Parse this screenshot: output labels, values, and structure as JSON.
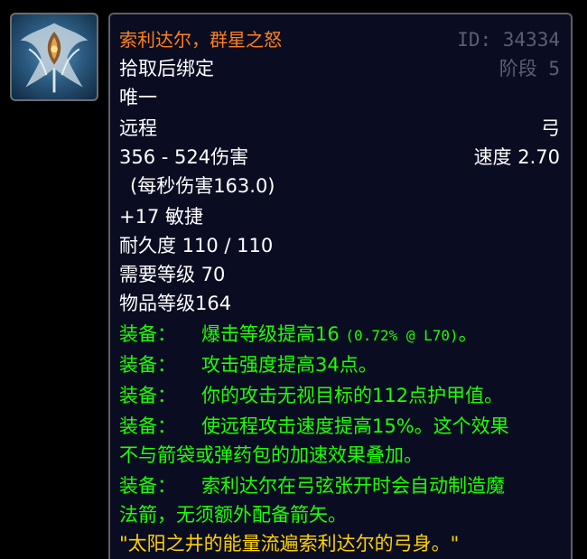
{
  "item": {
    "name": "索利达尔，群星之怒",
    "id_text": "ID: 34334",
    "phase_text": "阶段 5",
    "bind": "拾取后绑定",
    "unique": "唯一",
    "slot": "远程",
    "type": "弓",
    "damage": "356 - 524伤害",
    "speed": "速度 2.70",
    "dps": "(每秒伤害163.0)",
    "agility": "+17 敏捷",
    "durability": "耐久度 110 / 110",
    "req_level": "需要等级 70",
    "item_level": "物品等级164",
    "equip_label": "装备：",
    "equips": [
      {
        "text": "爆击等级提高16",
        "stat": "(0.72% @ L70)",
        "suffix": "。"
      },
      {
        "text": "攻击强度提高34点。"
      },
      {
        "text": "你的攻击无视目标的112点护甲值。"
      },
      {
        "text": "使远程攻击速度提高15%。这个效果",
        "cont": "不与箭袋或弹药包的加速效果叠加。"
      },
      {
        "text": "索利达尔在弓弦张开时会自动制造魔",
        "cont": "法箭，无须额外配备箭矢。"
      }
    ],
    "flavor": "\"太阳之井的能量流遍索利达尔的弓身。\""
  },
  "colors": {
    "name": "#ff7f1a",
    "equip": "#1eff00",
    "flavor": "#ffd100",
    "meta": "#5b5f75",
    "background": "#0a0d21"
  },
  "icon": "bow-thori-dal-icon"
}
